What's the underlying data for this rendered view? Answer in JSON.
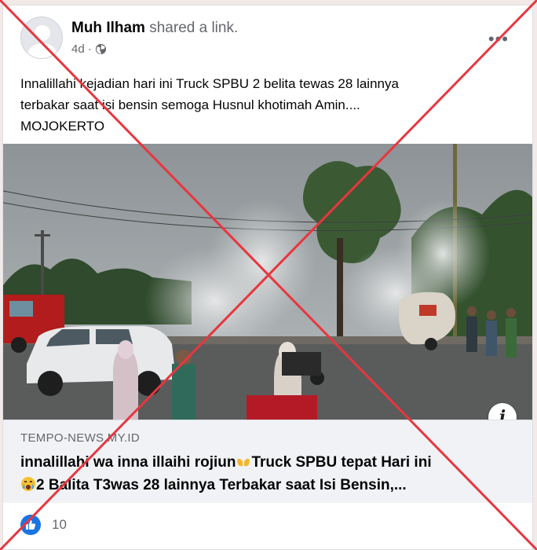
{
  "post": {
    "author": "Muh Ilham",
    "action": " shared a link.",
    "time": "4d",
    "separator": " · ",
    "privacy_icon": "globe-icon",
    "more_icon": "more-options-icon",
    "text": "Innalillahi  kejadian hari ini Truck SPBU 2 belita tewas 28 lainnya\nterbakar  saat isi bensin semoga Husnul khotimah Amin....\nMOJOKERTO"
  },
  "link_preview": {
    "domain": "TEMPO-NEWS.MY.ID",
    "title_part1": "innalillahi wa inna illaihi rojiun",
    "title_part2": "Truck SPBU tepat Hari ini",
    "title_part3": "2 Balita T3was 28 lainnya Terbakar saat Isi Bensin,...",
    "emoji_1": "palms-up-emoji",
    "emoji_2": "crying-face-emoji",
    "info_icon": "info-icon",
    "info_label": "i"
  },
  "reactions": {
    "icon": "like-icon",
    "count": "10"
  },
  "overlay": {
    "mark": "red-x-cross",
    "color": "#e8363f"
  }
}
